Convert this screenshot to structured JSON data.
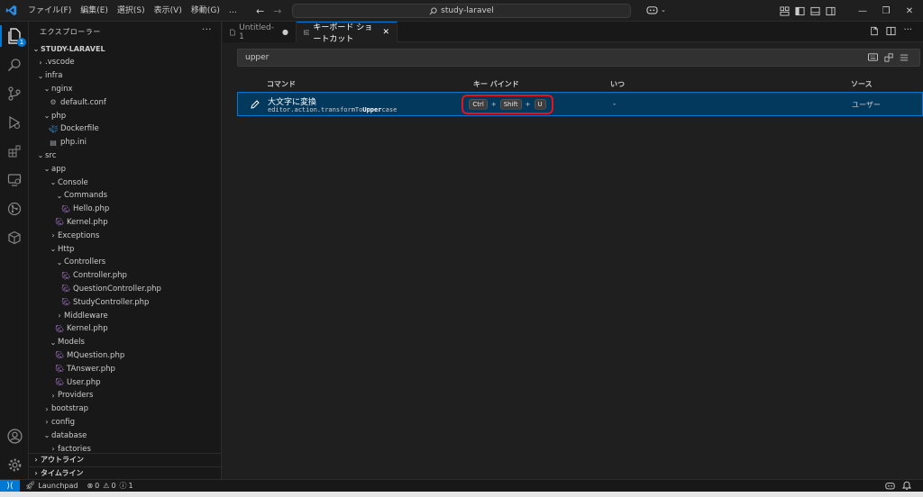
{
  "titlebar": {
    "menus": [
      "ファイル(F)",
      "編集(E)",
      "選択(S)",
      "表示(V)",
      "移動(G)",
      "…"
    ],
    "search": "study-laravel"
  },
  "activity": {
    "explorer_badge": "1"
  },
  "sidebar": {
    "header": "エクスプローラー",
    "root": "STUDY-LARAVEL",
    "tree": [
      {
        "label": ".vscode",
        "depth": 1,
        "type": "folder-closed"
      },
      {
        "label": "infra",
        "depth": 1,
        "type": "folder-open"
      },
      {
        "label": "nginx",
        "depth": 2,
        "type": "folder-open"
      },
      {
        "label": "default.conf",
        "depth": 3,
        "type": "gear-file"
      },
      {
        "label": "php",
        "depth": 2,
        "type": "folder-open"
      },
      {
        "label": "Dockerfile",
        "depth": 3,
        "type": "docker-file"
      },
      {
        "label": "php.ini",
        "depth": 3,
        "type": "ini-file"
      },
      {
        "label": "src",
        "depth": 1,
        "type": "folder-open"
      },
      {
        "label": "app",
        "depth": 2,
        "type": "folder-open"
      },
      {
        "label": "Console",
        "depth": 3,
        "type": "folder-open"
      },
      {
        "label": "Commands",
        "depth": 4,
        "type": "folder-open"
      },
      {
        "label": "Hello.php",
        "depth": 5,
        "type": "php-file"
      },
      {
        "label": "Kernel.php",
        "depth": 4,
        "type": "php-file"
      },
      {
        "label": "Exceptions",
        "depth": 3,
        "type": "folder-closed"
      },
      {
        "label": "Http",
        "depth": 3,
        "type": "folder-open"
      },
      {
        "label": "Controllers",
        "depth": 4,
        "type": "folder-open"
      },
      {
        "label": "Controller.php",
        "depth": 5,
        "type": "php-file"
      },
      {
        "label": "QuestionController.php",
        "depth": 5,
        "type": "php-file"
      },
      {
        "label": "StudyController.php",
        "depth": 5,
        "type": "php-file"
      },
      {
        "label": "Middleware",
        "depth": 4,
        "type": "folder-closed"
      },
      {
        "label": "Kernel.php",
        "depth": 4,
        "type": "php-file"
      },
      {
        "label": "Models",
        "depth": 3,
        "type": "folder-open"
      },
      {
        "label": "MQuestion.php",
        "depth": 4,
        "type": "php-file"
      },
      {
        "label": "TAnswer.php",
        "depth": 4,
        "type": "php-file"
      },
      {
        "label": "User.php",
        "depth": 4,
        "type": "php-file"
      },
      {
        "label": "Providers",
        "depth": 3,
        "type": "folder-closed"
      },
      {
        "label": "bootstrap",
        "depth": 2,
        "type": "folder-closed"
      },
      {
        "label": "config",
        "depth": 2,
        "type": "folder-closed"
      },
      {
        "label": "database",
        "depth": 2,
        "type": "folder-open"
      },
      {
        "label": "factories",
        "depth": 3,
        "type": "folder-closed"
      }
    ],
    "outline": "アウトライン",
    "timeline": "タイムライン"
  },
  "tabs": [
    {
      "label": "Untitled-1"
    },
    {
      "label": "キーボード ショートカット"
    }
  ],
  "keybindings": {
    "search_value": "upper",
    "headers": {
      "command": "コマンド",
      "keybinding": "キー バインド",
      "when": "いつ",
      "source": "ソース"
    },
    "rows": [
      {
        "title": "大文字に変換",
        "command_prefix": "editor.action.transformTo",
        "command_match": "Upper",
        "command_suffix": "case",
        "keys": [
          "Ctrl",
          "Shift",
          "U"
        ],
        "plus": "+",
        "when": "-",
        "source": "ユーザー"
      }
    ]
  },
  "status": {
    "launchpad": "Launchpad",
    "errors": "0",
    "warnings": "0",
    "info": "1"
  }
}
